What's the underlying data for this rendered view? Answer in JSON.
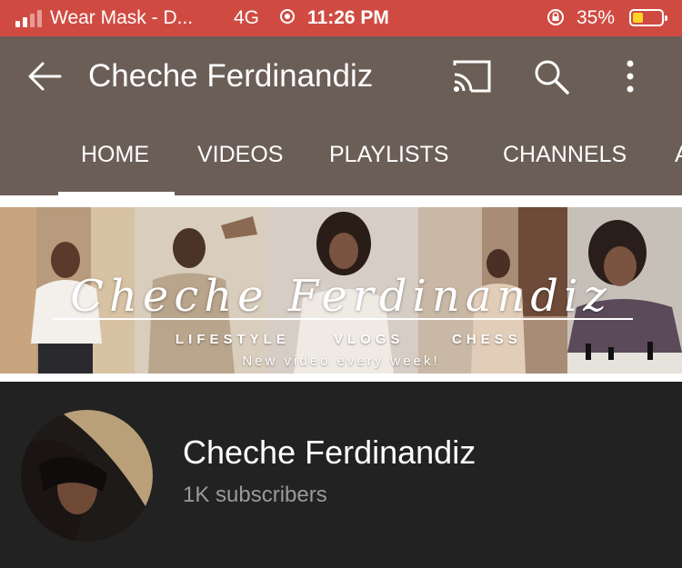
{
  "status_bar": {
    "carrier": "Wear Mask - D...",
    "network": "4G",
    "time": "11:26 PM",
    "battery_percent": "35%",
    "battery_level": 0.35,
    "battery_color": "#ffd426",
    "background_color": "#cf4b42"
  },
  "app_bar": {
    "title": "Cheche Ferdinandiz",
    "background_color": "#6b5e56",
    "icons": [
      "back-arrow-icon",
      "cast-icon",
      "search-icon",
      "more-vert-icon"
    ]
  },
  "tabs": {
    "items": [
      "HOME",
      "VIDEOS",
      "PLAYLISTS",
      "CHANNELS",
      "A"
    ],
    "selected": "HOME"
  },
  "banner": {
    "title": "Cheche Ferdinandiz",
    "categories": [
      "LIFESTYLE",
      "VLOGS",
      "CHESS"
    ],
    "tagline": "New video every week!"
  },
  "channel": {
    "name": "Cheche Ferdinandiz",
    "subscribers": "1K subscribers"
  }
}
